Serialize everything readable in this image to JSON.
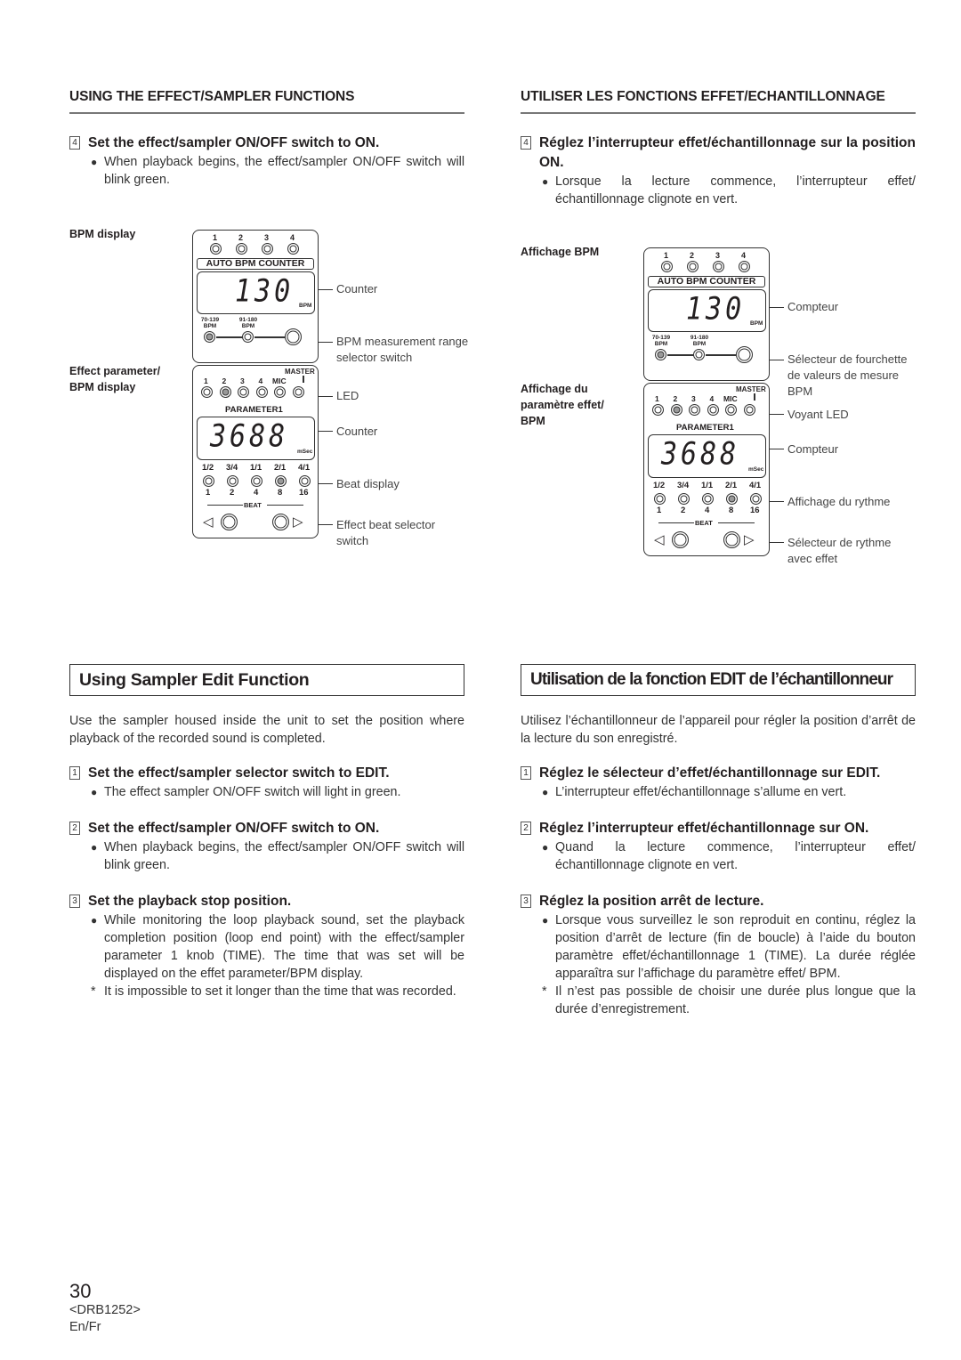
{
  "en": {
    "section_heading": "USING THE EFFECT/SAMPLER FUNCTIONS",
    "step4": {
      "num": "4",
      "title": "Set the effect/sampler ON/OFF switch to ON.",
      "bullet": "When playback begins, the effect/sampler ON/OFF switch will blink green."
    },
    "figure": {
      "label_bpm": "BPM display",
      "label_effect": "Effect parameter/ BPM display",
      "callouts": [
        "Counter",
        "BPM measurement range selector switch",
        "LED",
        "Counter",
        "Beat display",
        "Effect beat selector switch"
      ]
    },
    "edit_title": "Using Sampler Edit Function",
    "intro": "Use the sampler housed inside the unit to set the position where playback of the recorded sound is completed.",
    "steps": [
      {
        "num": "1",
        "title": "Set the effect/sampler selector switch to EDIT.",
        "bullet": "The effect sampler ON/OFF switch will light in green."
      },
      {
        "num": "2",
        "title": "Set the effect/sampler ON/OFF switch to ON.",
        "bullet": "When playback begins, the effect/sampler ON/OFF switch will blink green."
      },
      {
        "num": "3",
        "title": "Set the playback stop position.",
        "bullet": "While monitoring the loop playback sound, set the playback completion position (loop end point) with the effect/sampler parameter 1 knob (TIME). The time that was set will be displayed on the effet parameter/BPM display.",
        "note": "It is impossible to set it longer than the time that was recorded."
      }
    ]
  },
  "fr": {
    "section_heading": "UTILISER LES FONCTIONS EFFET/ECHANTILLONNAGE",
    "step4": {
      "num": "4",
      "title": "Réglez l’interrupteur effet/échantillonnage sur la position ON.",
      "bullet": "Lorsque la lecture commence, l’interrupteur effet/ échantillonnage clignote en vert."
    },
    "figure": {
      "label_bpm": "Affichage BPM",
      "label_effect": "Affichage du paramètre effet/ BPM",
      "callouts": [
        "Compteur",
        "Sélecteur de fourchette de valeurs de mesure BPM",
        "Voyant LED",
        "Compteur",
        "Affichage du rythme",
        "Sélecteur de rythme avec effet"
      ]
    },
    "edit_title": "Utilisation de la fonction EDIT de l’échantillonneur",
    "intro": "Utilisez l’échantillonneur de l’appareil pour régler la position d’arrêt de la lecture du son enregistré.",
    "steps": [
      {
        "num": "1",
        "title": "Réglez le sélecteur d’effet/échantillonnage sur EDIT.",
        "bullet": "L’interrupteur effet/échantillonnage s’allume en vert."
      },
      {
        "num": "2",
        "title": "Réglez l’interrupteur effet/échantillonnage sur ON.",
        "bullet": "Quand la lecture commence, l’interrupteur effet/ échantillonnage clignote en vert."
      },
      {
        "num": "3",
        "title": "Réglez la position arrêt de lecture.",
        "bullet": "Lorsque vous surveillez le son reproduit en continu, réglez la position d’arrêt de lecture (fin de boucle) à l’aide du bouton paramètre effet/échantillonnage 1 (TIME). La durée réglée apparaîtra sur l’affichage du paramètre effet/ BPM.",
        "note": "Il n’est pas possible de choisir une durée plus longue que la durée d’enregistrement."
      }
    ]
  },
  "panel": {
    "bpm": {
      "channels": [
        "1",
        "2",
        "3",
        "4"
      ],
      "counter_label": "AUTO BPM COUNTER",
      "value": "130",
      "unit": "BPM",
      "ranges": [
        "70-139\nBPM",
        "91-180\nBPM"
      ],
      "active_range_index": 0
    },
    "effect": {
      "channels": [
        "1",
        "2",
        "3",
        "4",
        "MIC"
      ],
      "master": "MASTER",
      "active_channel_index": 1,
      "param_label": "PARAMETER1",
      "value": "3688",
      "unit": "mSec",
      "beat_fracs": [
        "1/2",
        "3/4",
        "1/1",
        "2/1",
        "4/1"
      ],
      "beat_nums": [
        "1",
        "2",
        "4",
        "8",
        "16"
      ],
      "active_beat_index": 3,
      "beat_label": "BEAT",
      "left_arrow": "◁",
      "right_arrow": "▷"
    }
  },
  "footer": {
    "page_number": "30",
    "doc_code": "<DRB1252>",
    "lang": "En/Fr"
  }
}
